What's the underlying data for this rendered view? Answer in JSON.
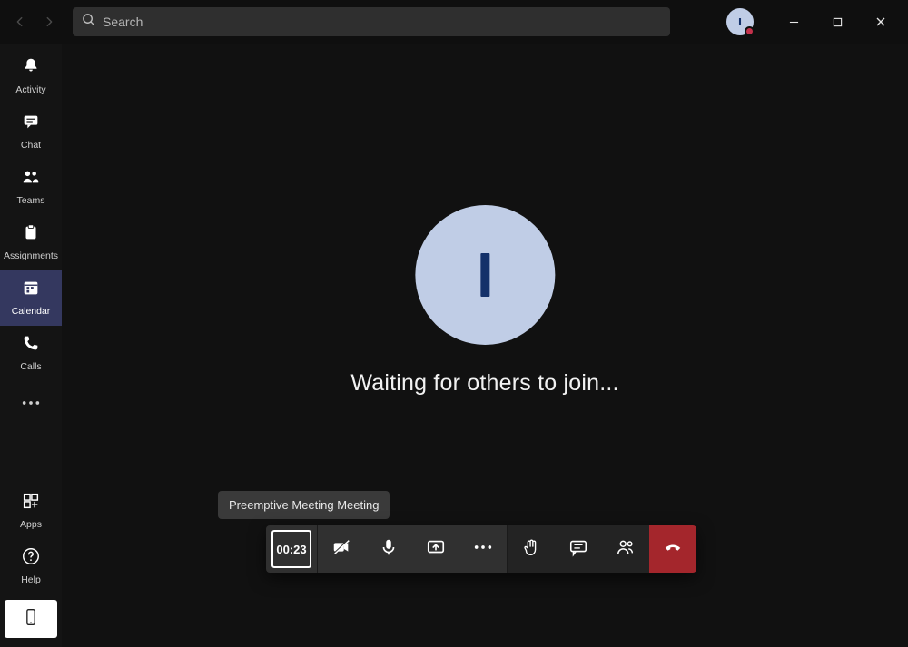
{
  "search": {
    "placeholder": "Search"
  },
  "rail": {
    "activity": "Activity",
    "chat": "Chat",
    "teams": "Teams",
    "assignments": "Assignments",
    "calendar": "Calendar",
    "calls": "Calls",
    "apps": "Apps",
    "help": "Help"
  },
  "avatar": {
    "initial": "I"
  },
  "meeting": {
    "waiting_text": "Waiting for others to join...",
    "tooltip": "Preemptive Meeting Meeting",
    "timer": "00:23"
  },
  "colors": {
    "avatar_bg": "#c0cde6",
    "hangup": "#a4262c",
    "active_rail": "#34385f"
  }
}
